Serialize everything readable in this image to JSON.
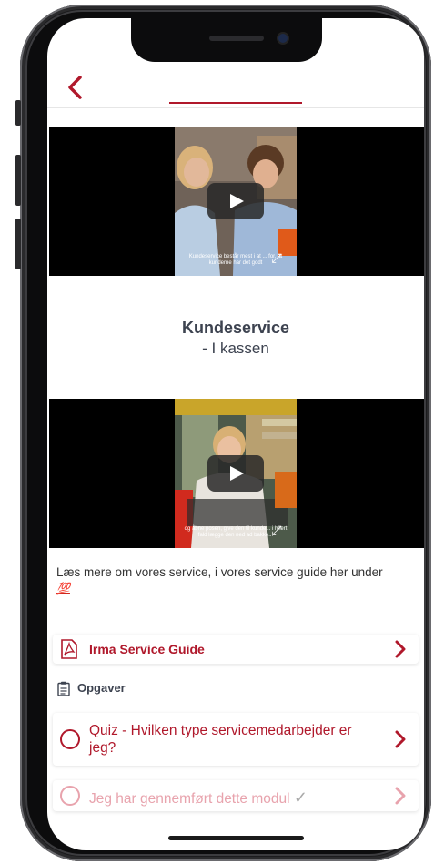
{
  "section": {
    "title": "Kundeservice",
    "subtitle": "- I kassen"
  },
  "videos": [
    {
      "caption": "Kundeservice består mest i at ... for, at kunderne har det godt"
    },
    {
      "caption": "og åbne posen, give den til kunde... i hvert fald lægge den ned ad bakke..."
    }
  ],
  "description": {
    "text": "Læs mere om vores service, i vores service guide her under",
    "emoji": "💯"
  },
  "guide": {
    "label": "Irma Service Guide"
  },
  "tasks": {
    "heading": "Opgaver",
    "quiz": "Quiz - Hvilken type servicemedarbejder er jeg?",
    "done": "Jeg har gennemført dette modul",
    "done_check": "✓"
  },
  "colors": {
    "accent": "#b0182b",
    "text": "#3d4350",
    "muted": "#e8a3ad"
  }
}
